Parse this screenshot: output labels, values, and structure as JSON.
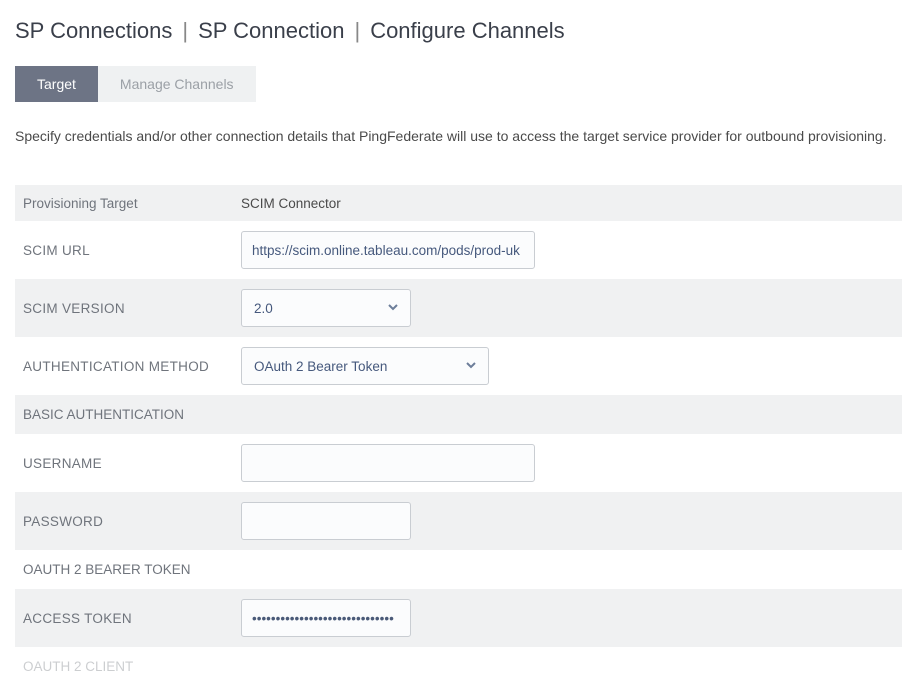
{
  "breadcrumb": {
    "items": [
      "SP Connections",
      "SP Connection",
      "Configure Channels"
    ]
  },
  "tabs": {
    "target": "Target",
    "manage_channels": "Manage Channels"
  },
  "description": "Specify credentials and/or other connection details that PingFederate will use to access the target service provider for outbound provisioning.",
  "form": {
    "provisioning_target_label": "Provisioning Target",
    "provisioning_target_value": "SCIM Connector",
    "scim_url_label": "SCIM URL",
    "scim_url_value": "https://scim.online.tableau.com/pods/prod-uk",
    "scim_version_label": "SCIM VERSION",
    "scim_version_value": "2.0",
    "auth_method_label": "AUTHENTICATION METHOD",
    "auth_method_value": "OAuth 2 Bearer Token",
    "basic_auth_header": "BASIC AUTHENTICATION",
    "username_label": "USERNAME",
    "username_value": "",
    "password_label": "PASSWORD",
    "password_value": "",
    "oauth_bearer_header": "OAUTH 2 BEARER TOKEN",
    "access_token_label": "ACCESS TOKEN",
    "access_token_value": "••••••••••••••••••••••••••••••",
    "oauth_client_header": "OAUTH 2 CLIENT"
  }
}
